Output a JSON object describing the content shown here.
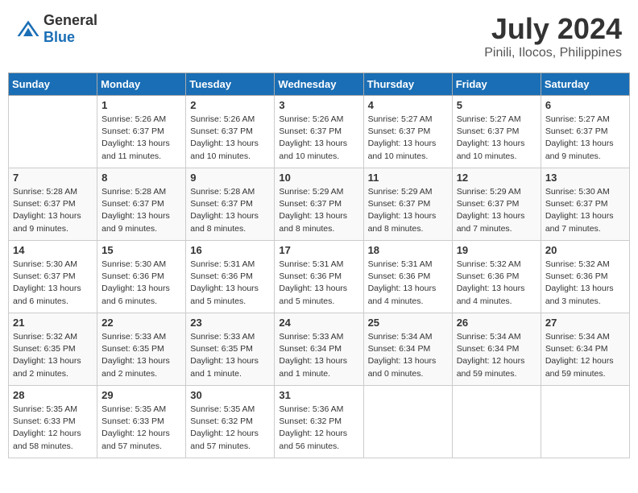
{
  "header": {
    "logo_general": "General",
    "logo_blue": "Blue",
    "title": "July 2024",
    "subtitle": "Pinili, Ilocos, Philippines"
  },
  "weekdays": [
    "Sunday",
    "Monday",
    "Tuesday",
    "Wednesday",
    "Thursday",
    "Friday",
    "Saturday"
  ],
  "weeks": [
    [
      {
        "day": "",
        "sunrise": "",
        "sunset": "",
        "daylight": ""
      },
      {
        "day": "1",
        "sunrise": "Sunrise: 5:26 AM",
        "sunset": "Sunset: 6:37 PM",
        "daylight": "Daylight: 13 hours and 11 minutes."
      },
      {
        "day": "2",
        "sunrise": "Sunrise: 5:26 AM",
        "sunset": "Sunset: 6:37 PM",
        "daylight": "Daylight: 13 hours and 10 minutes."
      },
      {
        "day": "3",
        "sunrise": "Sunrise: 5:26 AM",
        "sunset": "Sunset: 6:37 PM",
        "daylight": "Daylight: 13 hours and 10 minutes."
      },
      {
        "day": "4",
        "sunrise": "Sunrise: 5:27 AM",
        "sunset": "Sunset: 6:37 PM",
        "daylight": "Daylight: 13 hours and 10 minutes."
      },
      {
        "day": "5",
        "sunrise": "Sunrise: 5:27 AM",
        "sunset": "Sunset: 6:37 PM",
        "daylight": "Daylight: 13 hours and 10 minutes."
      },
      {
        "day": "6",
        "sunrise": "Sunrise: 5:27 AM",
        "sunset": "Sunset: 6:37 PM",
        "daylight": "Daylight: 13 hours and 9 minutes."
      }
    ],
    [
      {
        "day": "7",
        "sunrise": "Sunrise: 5:28 AM",
        "sunset": "Sunset: 6:37 PM",
        "daylight": "Daylight: 13 hours and 9 minutes."
      },
      {
        "day": "8",
        "sunrise": "Sunrise: 5:28 AM",
        "sunset": "Sunset: 6:37 PM",
        "daylight": "Daylight: 13 hours and 9 minutes."
      },
      {
        "day": "9",
        "sunrise": "Sunrise: 5:28 AM",
        "sunset": "Sunset: 6:37 PM",
        "daylight": "Daylight: 13 hours and 8 minutes."
      },
      {
        "day": "10",
        "sunrise": "Sunrise: 5:29 AM",
        "sunset": "Sunset: 6:37 PM",
        "daylight": "Daylight: 13 hours and 8 minutes."
      },
      {
        "day": "11",
        "sunrise": "Sunrise: 5:29 AM",
        "sunset": "Sunset: 6:37 PM",
        "daylight": "Daylight: 13 hours and 8 minutes."
      },
      {
        "day": "12",
        "sunrise": "Sunrise: 5:29 AM",
        "sunset": "Sunset: 6:37 PM",
        "daylight": "Daylight: 13 hours and 7 minutes."
      },
      {
        "day": "13",
        "sunrise": "Sunrise: 5:30 AM",
        "sunset": "Sunset: 6:37 PM",
        "daylight": "Daylight: 13 hours and 7 minutes."
      }
    ],
    [
      {
        "day": "14",
        "sunrise": "Sunrise: 5:30 AM",
        "sunset": "Sunset: 6:37 PM",
        "daylight": "Daylight: 13 hours and 6 minutes."
      },
      {
        "day": "15",
        "sunrise": "Sunrise: 5:30 AM",
        "sunset": "Sunset: 6:36 PM",
        "daylight": "Daylight: 13 hours and 6 minutes."
      },
      {
        "day": "16",
        "sunrise": "Sunrise: 5:31 AM",
        "sunset": "Sunset: 6:36 PM",
        "daylight": "Daylight: 13 hours and 5 minutes."
      },
      {
        "day": "17",
        "sunrise": "Sunrise: 5:31 AM",
        "sunset": "Sunset: 6:36 PM",
        "daylight": "Daylight: 13 hours and 5 minutes."
      },
      {
        "day": "18",
        "sunrise": "Sunrise: 5:31 AM",
        "sunset": "Sunset: 6:36 PM",
        "daylight": "Daylight: 13 hours and 4 minutes."
      },
      {
        "day": "19",
        "sunrise": "Sunrise: 5:32 AM",
        "sunset": "Sunset: 6:36 PM",
        "daylight": "Daylight: 13 hours and 4 minutes."
      },
      {
        "day": "20",
        "sunrise": "Sunrise: 5:32 AM",
        "sunset": "Sunset: 6:36 PM",
        "daylight": "Daylight: 13 hours and 3 minutes."
      }
    ],
    [
      {
        "day": "21",
        "sunrise": "Sunrise: 5:32 AM",
        "sunset": "Sunset: 6:35 PM",
        "daylight": "Daylight: 13 hours and 2 minutes."
      },
      {
        "day": "22",
        "sunrise": "Sunrise: 5:33 AM",
        "sunset": "Sunset: 6:35 PM",
        "daylight": "Daylight: 13 hours and 2 minutes."
      },
      {
        "day": "23",
        "sunrise": "Sunrise: 5:33 AM",
        "sunset": "Sunset: 6:35 PM",
        "daylight": "Daylight: 13 hours and 1 minute."
      },
      {
        "day": "24",
        "sunrise": "Sunrise: 5:33 AM",
        "sunset": "Sunset: 6:34 PM",
        "daylight": "Daylight: 13 hours and 1 minute."
      },
      {
        "day": "25",
        "sunrise": "Sunrise: 5:34 AM",
        "sunset": "Sunset: 6:34 PM",
        "daylight": "Daylight: 13 hours and 0 minutes."
      },
      {
        "day": "26",
        "sunrise": "Sunrise: 5:34 AM",
        "sunset": "Sunset: 6:34 PM",
        "daylight": "Daylight: 12 hours and 59 minutes."
      },
      {
        "day": "27",
        "sunrise": "Sunrise: 5:34 AM",
        "sunset": "Sunset: 6:34 PM",
        "daylight": "Daylight: 12 hours and 59 minutes."
      }
    ],
    [
      {
        "day": "28",
        "sunrise": "Sunrise: 5:35 AM",
        "sunset": "Sunset: 6:33 PM",
        "daylight": "Daylight: 12 hours and 58 minutes."
      },
      {
        "day": "29",
        "sunrise": "Sunrise: 5:35 AM",
        "sunset": "Sunset: 6:33 PM",
        "daylight": "Daylight: 12 hours and 57 minutes."
      },
      {
        "day": "30",
        "sunrise": "Sunrise: 5:35 AM",
        "sunset": "Sunset: 6:32 PM",
        "daylight": "Daylight: 12 hours and 57 minutes."
      },
      {
        "day": "31",
        "sunrise": "Sunrise: 5:36 AM",
        "sunset": "Sunset: 6:32 PM",
        "daylight": "Daylight: 12 hours and 56 minutes."
      },
      {
        "day": "",
        "sunrise": "",
        "sunset": "",
        "daylight": ""
      },
      {
        "day": "",
        "sunrise": "",
        "sunset": "",
        "daylight": ""
      },
      {
        "day": "",
        "sunrise": "",
        "sunset": "",
        "daylight": ""
      }
    ]
  ]
}
